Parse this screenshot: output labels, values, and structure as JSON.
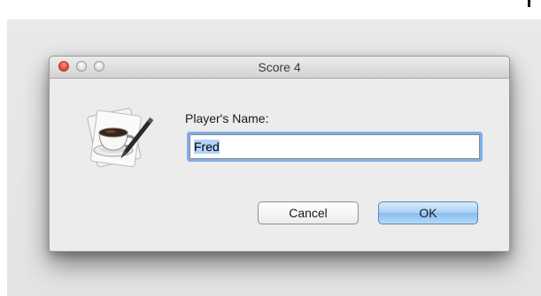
{
  "window": {
    "title": "Score 4"
  },
  "dialog": {
    "name_label": "Player's Name:",
    "name_value": "Fred",
    "cancel_label": "Cancel",
    "ok_label": "OK"
  },
  "icons": {
    "app_icon": "coffee-cup-pen-icon",
    "close": "close-button-icon",
    "minimize": "minimize-button-icon",
    "zoom": "zoom-button-icon"
  },
  "colors": {
    "close_red": "#f25346",
    "focus_ring": "#6ca5ea",
    "default_button": "#a9cff4",
    "selection": "#b3d3fb"
  }
}
